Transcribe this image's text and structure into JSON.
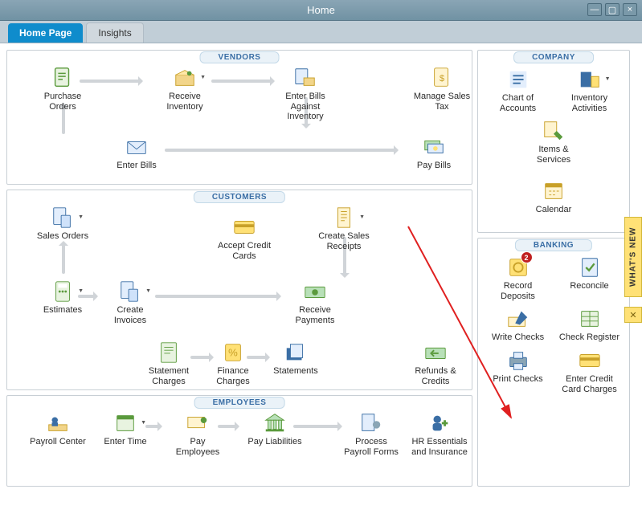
{
  "window": {
    "title": "Home"
  },
  "tabs": {
    "home": "Home Page",
    "insights": "Insights"
  },
  "sections": {
    "vendors": "VENDORS",
    "customers": "CUSTOMERS",
    "employees": "EMPLOYEES",
    "company": "COMPANY",
    "banking": "BANKING"
  },
  "vendors": {
    "purchase_orders": "Purchase Orders",
    "receive_inventory": "Receive Inventory",
    "enter_bills_against_inventory": "Enter Bills Against Inventory",
    "manage_sales_tax": "Manage Sales Tax",
    "enter_bills": "Enter Bills",
    "pay_bills": "Pay Bills"
  },
  "customers": {
    "sales_orders": "Sales Orders",
    "accept_credit_cards": "Accept Credit Cards",
    "create_sales_receipts": "Create Sales Receipts",
    "estimates": "Estimates",
    "create_invoices": "Create Invoices",
    "receive_payments": "Receive Payments",
    "statement_charges": "Statement Charges",
    "finance_charges": "Finance Charges",
    "statements": "Statements",
    "refunds_credits": "Refunds & Credits"
  },
  "employees": {
    "payroll_center": "Payroll Center",
    "enter_time": "Enter Time",
    "pay_employees": "Pay Employees",
    "pay_liabilities": "Pay Liabilities",
    "process_payroll_forms": "Process Payroll Forms",
    "hr_essentials": "HR Essentials and Insurance"
  },
  "company": {
    "chart_of_accounts": "Chart of Accounts",
    "inventory_activities": "Inventory Activities",
    "items_services": "Items & Services",
    "calendar": "Calendar"
  },
  "banking": {
    "record_deposits": "Record Deposits",
    "record_deposits_badge": "2",
    "reconcile": "Reconcile",
    "write_checks": "Write Checks",
    "check_register": "Check Register",
    "print_checks": "Print Checks",
    "enter_credit_card_charges": "Enter Credit Card Charges"
  },
  "whats_new": {
    "label": "WHAT'S NEW"
  }
}
